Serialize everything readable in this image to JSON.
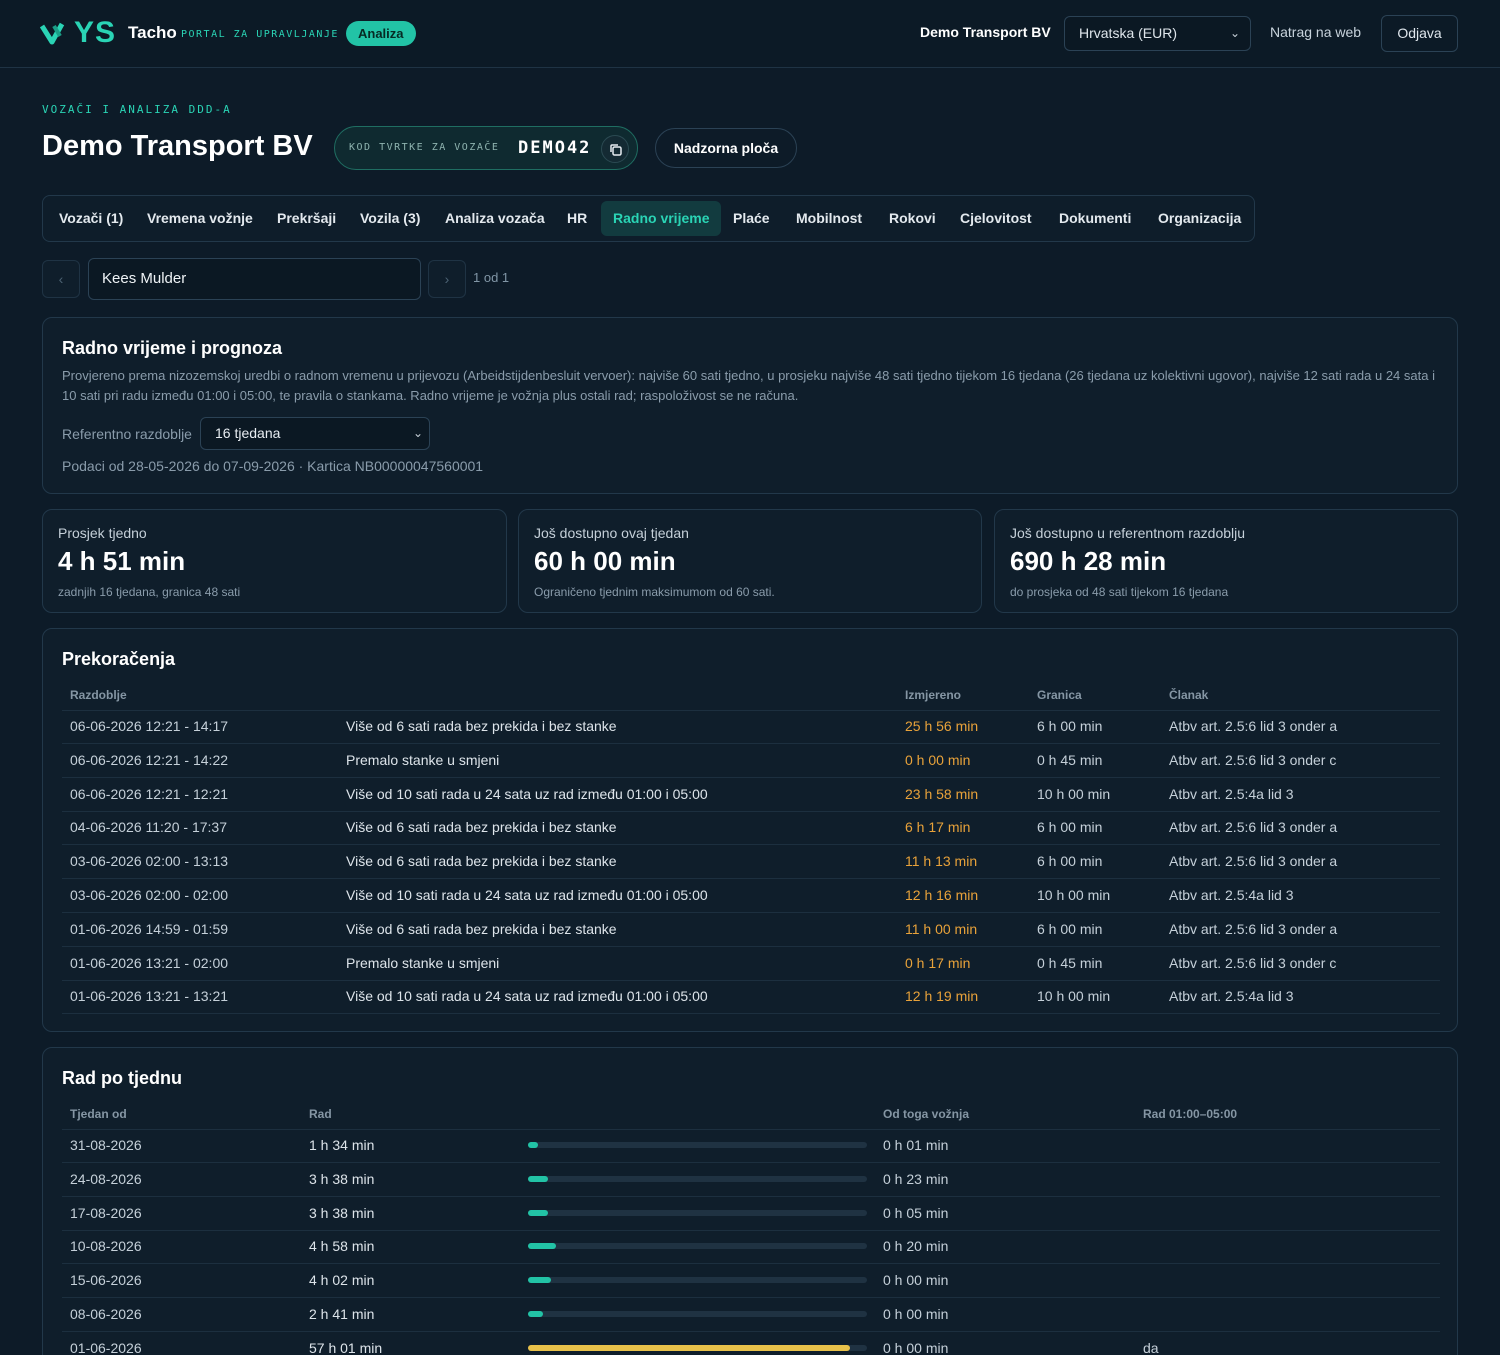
{
  "topbar": {
    "logo_text": "YS",
    "product": "Tacho",
    "portal_label": "PORTAL ZA UPRAVLJANJE",
    "badge": "Analiza",
    "company": "Demo Transport BV",
    "country_select": "Hrvatska (EUR)",
    "back_link": "Natrag na web",
    "logout": "Odjava"
  },
  "header": {
    "eyebrow": "VOZAČI I ANALIZA DDD-A",
    "title": "Demo Transport BV",
    "code_label": "KOD TVRTKE ZA VOZAČE",
    "code_value": "DEMO42",
    "dashboard_button": "Nadzorna ploča"
  },
  "tabs": [
    "Vozači (1)",
    "Vremena vožnje",
    "Prekršaji",
    "Vozila (3)",
    "Analiza vozača",
    "HR",
    "Radno vrijeme",
    "Plaće",
    "Mobilnost",
    "Rokovi",
    "Cjelovitost",
    "Dokumenti",
    "Organizacija"
  ],
  "active_tab": "Radno vrijeme",
  "pager": {
    "prev": "‹",
    "next": "›",
    "driver": "Kees Mulder",
    "count": "1 od 1"
  },
  "forecast": {
    "title": "Radno vrijeme i prognoza",
    "description": "Provjereno prema nizozemskoj uredbi o radnom vremenu u prijevozu (Arbeidstijdenbesluit vervoer): najviše 60 sati tjedno, u prosjeku najviše 48 sati tjedno tijekom 16 tjedana (26 tjedana uz kolektivni ugovor), najviše 12 sati rada u 24 sata i 10 sati pri radu između 01:00 i 05:00, te pravila o stankama. Radno vrijeme je vožnja plus ostali rad; raspoloživost se ne računa.",
    "ref_label": "Referentno razdoblje",
    "ref_value": "16 tjedana",
    "data_info": "Podaci od 28-05-2026 do 07-09-2026 · Kartica NB00000047560001"
  },
  "stats": [
    {
      "label": "Prosjek tjedno",
      "value": "4 h 51 min",
      "sub": "zadnjih 16 tjedana, granica 48 sati"
    },
    {
      "label": "Još dostupno ovaj tjedan",
      "value": "60 h 00 min",
      "sub": "Ograničeno tjednim maksimumom od 60 sati."
    },
    {
      "label": "Još dostupno u referentnom razdoblju",
      "value": "690 h 28 min",
      "sub": "do prosjeka od 48 sati tijekom 16 tjedana"
    }
  ],
  "violations": {
    "title": "Prekoračenja",
    "headers": {
      "period": "Razdoblje",
      "measured": "Izmjereno",
      "limit": "Granica",
      "article": "Članak"
    },
    "rows": [
      {
        "period": "06-06-2026 12:21 - 14:17",
        "desc": "Više od 6 sati rada bez prekida i bez stanke",
        "measured": "25 h 56 min",
        "limit": "6 h 00 min",
        "article": "Atbv art. 2.5:6 lid 3 onder a"
      },
      {
        "period": "06-06-2026 12:21 - 14:22",
        "desc": "Premalo stanke u smjeni",
        "measured": "0 h 00 min",
        "limit": "0 h 45 min",
        "article": "Atbv art. 2.5:6 lid 3 onder c"
      },
      {
        "period": "06-06-2026 12:21 - 12:21",
        "desc": "Više od 10 sati rada u 24 sata uz rad između 01:00 i 05:00",
        "measured": "23 h 58 min",
        "limit": "10 h 00 min",
        "article": "Atbv art. 2.5:4a lid 3"
      },
      {
        "period": "04-06-2026 11:20 - 17:37",
        "desc": "Više od 6 sati rada bez prekida i bez stanke",
        "measured": "6 h 17 min",
        "limit": "6 h 00 min",
        "article": "Atbv art. 2.5:6 lid 3 onder a"
      },
      {
        "period": "03-06-2026 02:00 - 13:13",
        "desc": "Više od 6 sati rada bez prekida i bez stanke",
        "measured": "11 h 13 min",
        "limit": "6 h 00 min",
        "article": "Atbv art. 2.5:6 lid 3 onder a"
      },
      {
        "period": "03-06-2026 02:00 - 02:00",
        "desc": "Više od 10 sati rada u 24 sata uz rad između 01:00 i 05:00",
        "measured": "12 h 16 min",
        "limit": "10 h 00 min",
        "article": "Atbv art. 2.5:4a lid 3"
      },
      {
        "period": "01-06-2026 14:59 - 01:59",
        "desc": "Više od 6 sati rada bez prekida i bez stanke",
        "measured": "11 h 00 min",
        "limit": "6 h 00 min",
        "article": "Atbv art. 2.5:6 lid 3 onder a"
      },
      {
        "period": "01-06-2026 13:21 - 02:00",
        "desc": "Premalo stanke u smjeni",
        "measured": "0 h 17 min",
        "limit": "0 h 45 min",
        "article": "Atbv art. 2.5:6 lid 3 onder c"
      },
      {
        "period": "01-06-2026 13:21 - 13:21",
        "desc": "Više od 10 sati rada u 24 sata uz rad između 01:00 i 05:00",
        "measured": "12 h 19 min",
        "limit": "10 h 00 min",
        "article": "Atbv art. 2.5:4a lid 3"
      }
    ]
  },
  "weekly": {
    "title": "Rad po tjednu",
    "headers": {
      "week": "Tjedan od",
      "work": "Rad",
      "driving": "Od toga vožnja",
      "night": "Rad 01:00–05:00"
    },
    "rows": [
      {
        "week": "31-08-2026",
        "work": "1 h 34 min",
        "fill": 0.03,
        "driving": "0 h 01 min",
        "night": ""
      },
      {
        "week": "24-08-2026",
        "work": "3 h 38 min",
        "fill": 0.06,
        "driving": "0 h 23 min",
        "night": ""
      },
      {
        "week": "17-08-2026",
        "work": "3 h 38 min",
        "fill": 0.06,
        "driving": "0 h 05 min",
        "night": ""
      },
      {
        "week": "10-08-2026",
        "work": "4 h 58 min",
        "fill": 0.083,
        "driving": "0 h 20 min",
        "night": ""
      },
      {
        "week": "15-06-2026",
        "work": "4 h 02 min",
        "fill": 0.067,
        "driving": "0 h 00 min",
        "night": ""
      },
      {
        "week": "08-06-2026",
        "work": "2 h 41 min",
        "fill": 0.045,
        "driving": "0 h 00 min",
        "night": ""
      },
      {
        "week": "01-06-2026",
        "work": "57 h 01 min",
        "fill": 0.95,
        "driving": "0 h 00 min",
        "night": "da",
        "warn": true
      }
    ]
  }
}
